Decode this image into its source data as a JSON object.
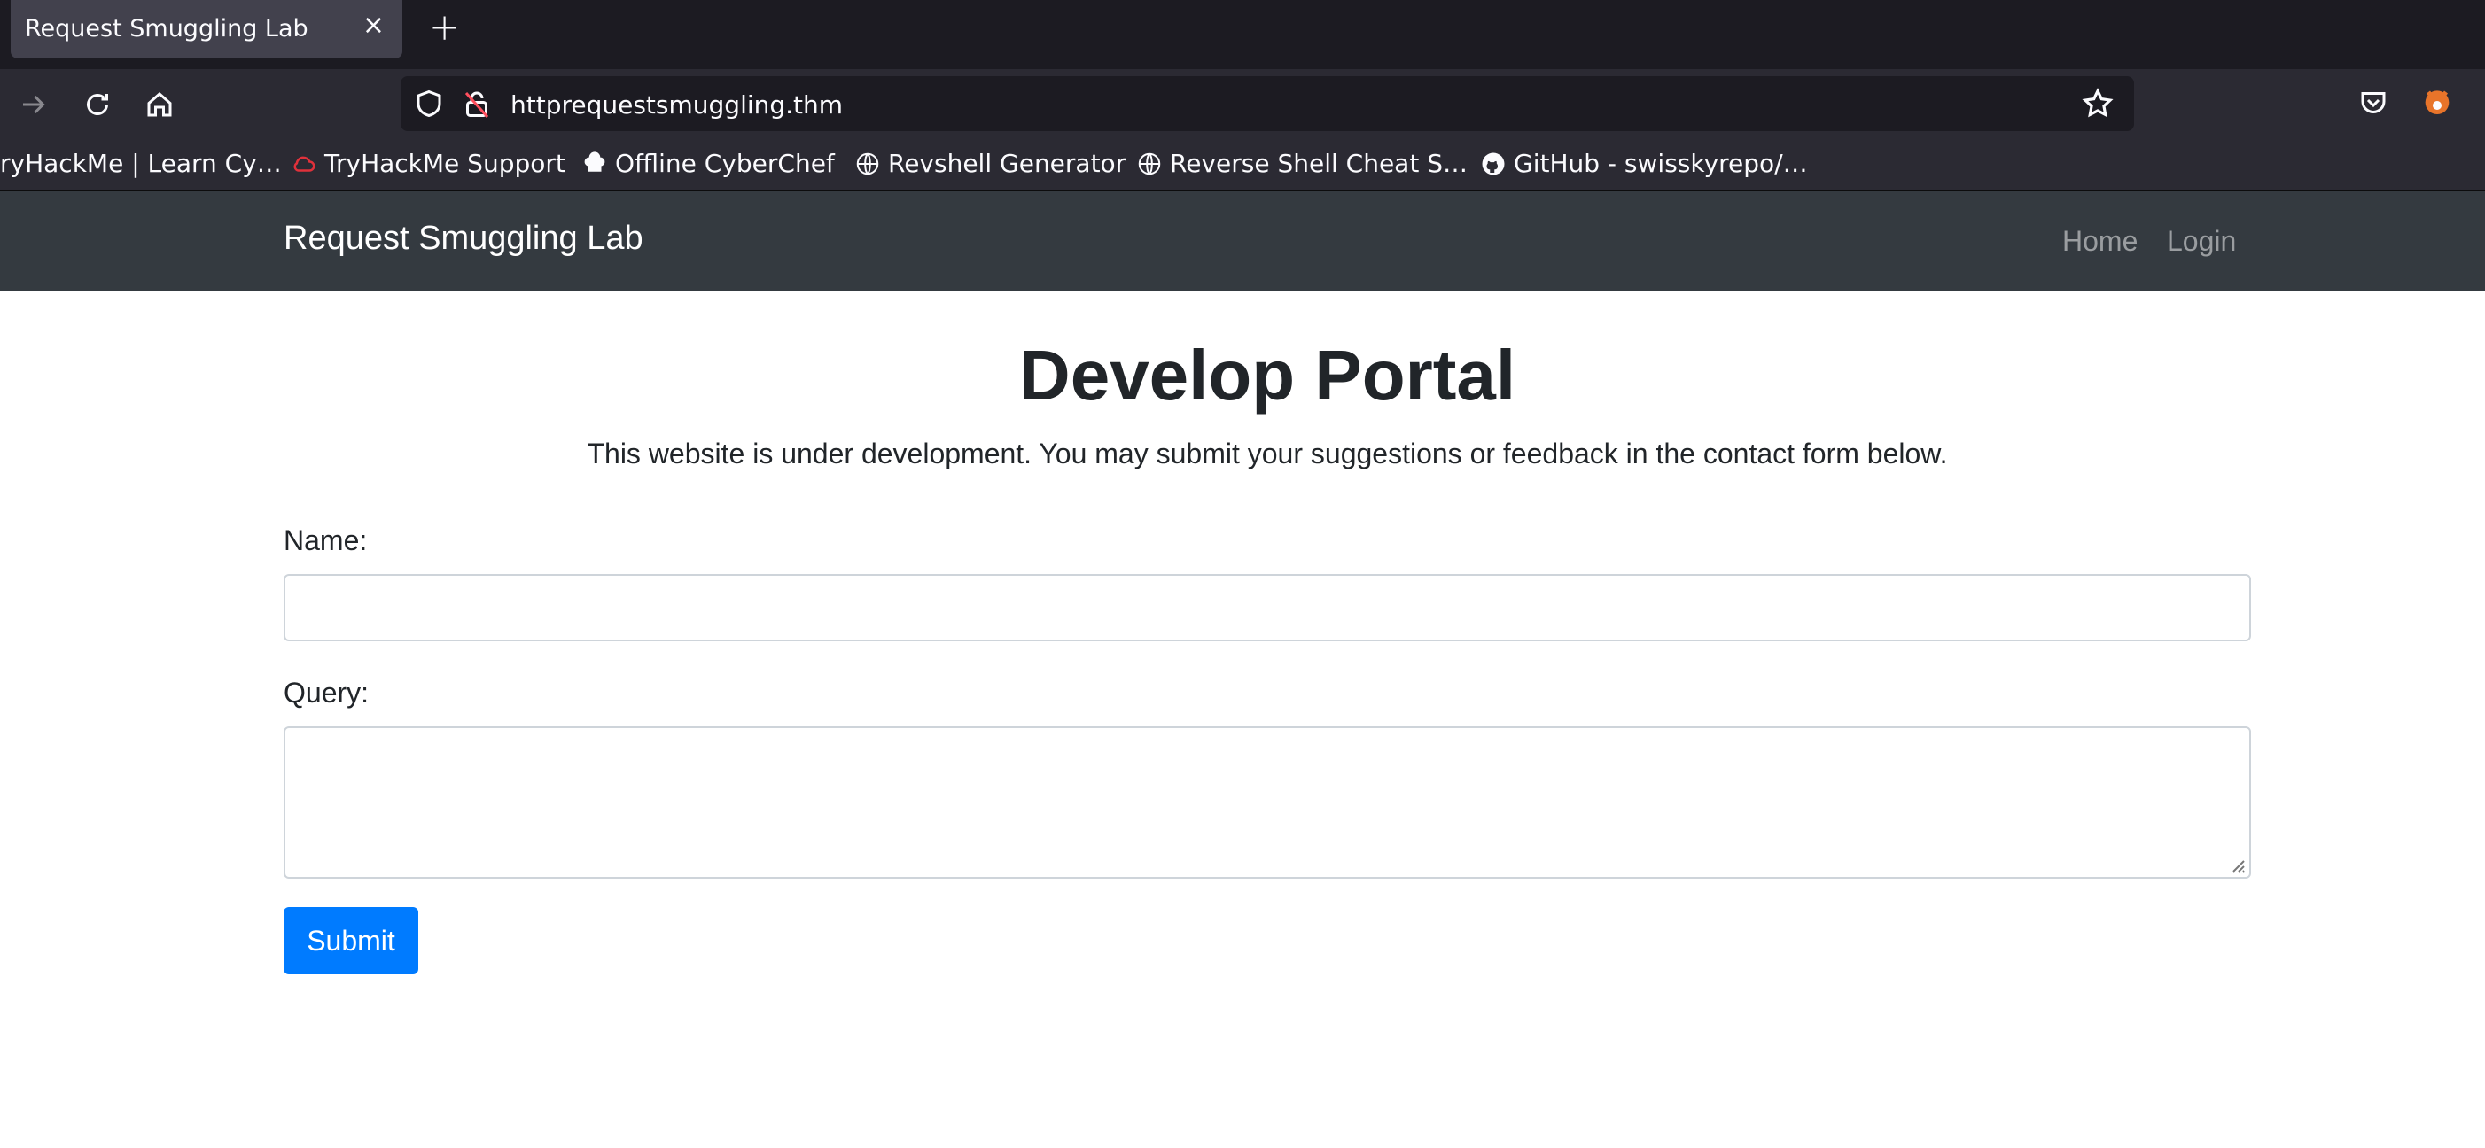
{
  "browser": {
    "tab_title": "Request Smuggling Lab",
    "tab_close": "×",
    "new_tab": "+",
    "url": "httprequestsmuggling.thm",
    "bookmarks": [
      {
        "label": "ryHackMe | Learn Cy…",
        "icon": "none"
      },
      {
        "label": "TryHackMe Support",
        "icon": "cloud-icon"
      },
      {
        "label": "Offline CyberChef",
        "icon": "chef-hat-icon"
      },
      {
        "label": "Revshell Generator",
        "icon": "globe-icon"
      },
      {
        "label": "Reverse Shell Cheat S…",
        "icon": "globe-icon"
      },
      {
        "label": "GitHub - swisskyrepo/…",
        "icon": "github-icon"
      }
    ]
  },
  "site": {
    "brand": "Request Smuggling Lab",
    "nav": [
      {
        "label": "Home"
      },
      {
        "label": "Login"
      }
    ],
    "heading": "Develop Portal",
    "lead": "This website is under development. You may submit your suggestions or feedback in the contact form below.",
    "form": {
      "name_label": "Name:",
      "name_value": "",
      "query_label": "Query:",
      "query_value": "",
      "submit_label": "Submit"
    }
  },
  "colors": {
    "navbar": "#343a40",
    "primary": "#007bff",
    "chrome_dark": "#1c1b22",
    "chrome": "#2b2a33"
  }
}
